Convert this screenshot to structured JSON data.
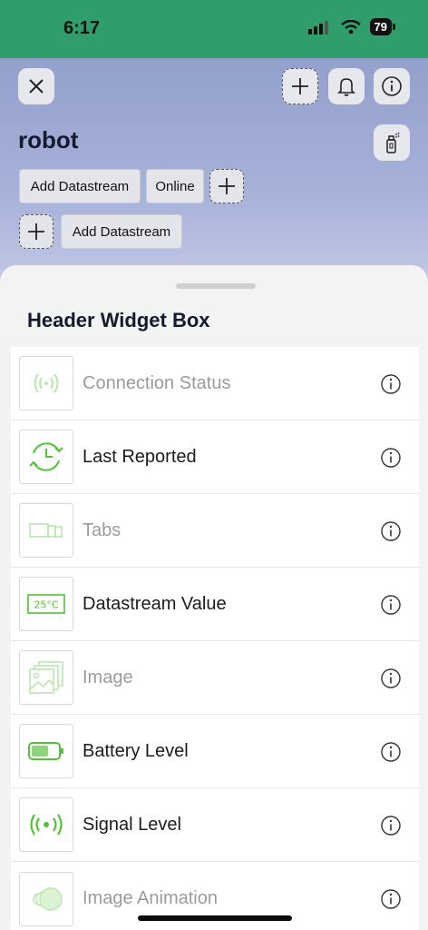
{
  "status": {
    "time": "6:17",
    "battery": "79"
  },
  "device": {
    "name": "robot"
  },
  "chips": {
    "add_datastream_1": "Add Datastream",
    "online": "Online",
    "add_datastream_2": "Add Datastream"
  },
  "sheet": {
    "title": "Header Widget Box",
    "items": [
      {
        "label": "Connection Status",
        "icon": "connection-status-icon",
        "enabled": false
      },
      {
        "label": "Last Reported",
        "icon": "last-reported-icon",
        "enabled": true
      },
      {
        "label": "Tabs",
        "icon": "tabs-icon",
        "enabled": false
      },
      {
        "label": "Datastream Value",
        "icon": "datastream-value-icon",
        "enabled": true,
        "icon_text": "25°C"
      },
      {
        "label": "Image",
        "icon": "image-icon",
        "enabled": false
      },
      {
        "label": "Battery Level",
        "icon": "battery-level-icon",
        "enabled": true
      },
      {
        "label": "Signal Level",
        "icon": "signal-level-icon",
        "enabled": true
      },
      {
        "label": "Image Animation",
        "icon": "image-animation-icon",
        "enabled": false
      }
    ]
  },
  "colors": {
    "status_bar": "#2f9e6a",
    "accent_green": "#52c23a",
    "hero_top": "#93a0cc"
  }
}
